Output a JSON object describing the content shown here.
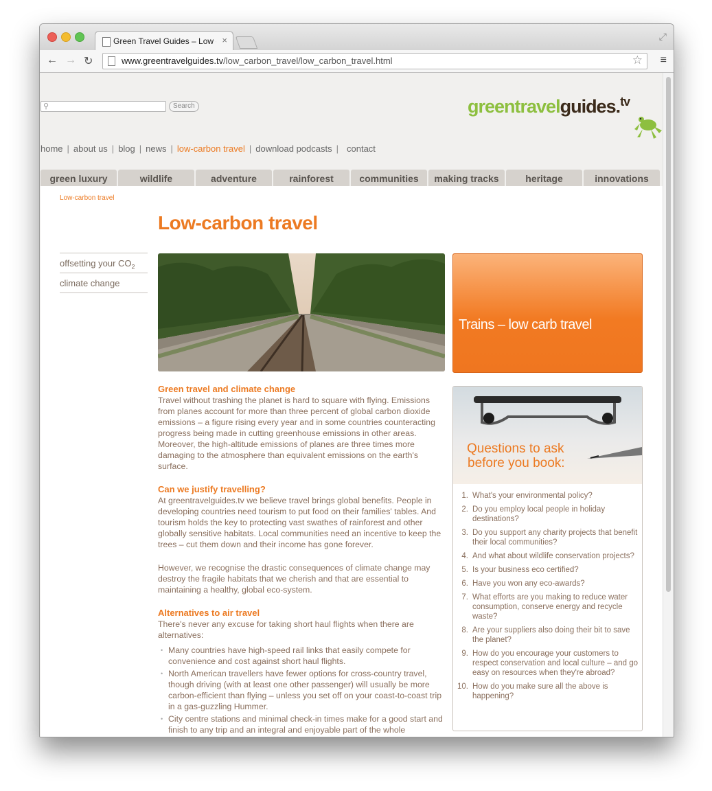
{
  "browser": {
    "tab_title": "Green Travel Guides – Low c",
    "url_host": "www.greentravelguides.tv",
    "url_path": "/low_carbon_travel/low_carbon_travel.html"
  },
  "header": {
    "search_button": "Search",
    "logo_green": "greentravel",
    "logo_dark": "guides.",
    "logo_tv": "tv"
  },
  "topnav": [
    "home",
    "about us",
    "blog",
    "news",
    "low-carbon travel",
    "download podcasts",
    "contact"
  ],
  "category_tabs": [
    "green luxury",
    "wildlife",
    "adventure",
    "rainforest",
    "communities",
    "making tracks",
    "heritage",
    "innovations"
  ],
  "breadcrumb": "Low-carbon travel",
  "page_title": "Low-carbon travel",
  "subnav": {
    "offsetting": "offsetting your CO",
    "offsetting_sub": "2",
    "climate": "climate change"
  },
  "promo": "Trains – low carb travel",
  "article": {
    "h1": "Green travel and climate change",
    "p1": "Travel without trashing the planet is hard to square with flying. Emissions from planes account for more than three percent of global carbon dioxide emissions – a figure rising every year and in some countries counteracting progress being made in cutting greenhouse emissions in other areas. Moreover, the high-altitude emissions of planes are three times more damaging to the atmosphere than equivalent emissions on the earth's surface.",
    "h2": "Can we justify travelling?",
    "p2": "At greentravelguides.tv we believe travel brings global benefits. People in developing countries need tourism to put food on their families' tables. And tourism holds the key to protecting vast swathes of rainforest and other globally sensitive habitats. Local communities need an incentive to keep the trees – cut them down and their income has gone forever.",
    "p3": "However, we recognise the drastic consequences of climate change may destroy the fragile habitats that we cherish and that are essential to maintaining a healthy, global eco-system.",
    "h3": "Alternatives to air travel",
    "p4": "There's never any excuse for taking short haul flights when there are alternatives:",
    "bullets": [
      "Many countries have high-speed rail links that easily compete for convenience and cost against short haul flights.",
      "North American travellers have fewer options for cross-country travel, though driving (with at least one other passenger) will usually be more carbon-efficient than flying – unless you set off on your coast-to-coast trip in a gas-guzzling Hummer.",
      "City centre stations and minimal check-in times make for a good start and finish to any trip and an integral and enjoyable part of the whole"
    ]
  },
  "questions": {
    "title_line1": "Questions to ask",
    "title_line2": "before you book:",
    "numbers": [
      "1.",
      "2.",
      "3.",
      "4.",
      "5.",
      "6.",
      "7.",
      "8.",
      "9.",
      "10."
    ],
    "items": [
      "What's your environmental policy?",
      "Do you employ local people in holiday destinations?",
      "Do you support any charity projects that benefit their local communities?",
      "And what about wildlife conservation projects?",
      "Is your business eco certified?",
      "Have you won any eco-awards?",
      "What efforts are you making to reduce water consumption, conserve energy and recycle waste?",
      "Are your suppliers also doing their bit to save the planet?",
      "How do you encourage your customers to respect conservation and local culture – and go easy on resources when they're abroad?",
      "How do you make sure all the above is happening?"
    ]
  },
  "colors": {
    "accent": "#ec7a22",
    "logo_green": "#8dbf3f",
    "text": "#8a6f5d"
  }
}
